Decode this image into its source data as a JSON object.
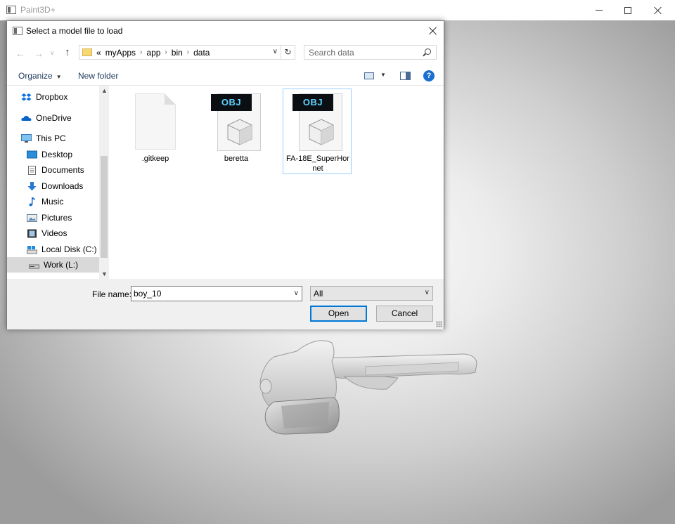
{
  "app": {
    "title": "Paint3D+"
  },
  "dialog": {
    "title": "Select a model file to load",
    "breadcrumb": [
      "«",
      "myApps",
      "app",
      "bin",
      "data"
    ],
    "search_placeholder": "Search data",
    "toolbar": {
      "organize_label": "Organize",
      "new_folder_label": "New folder"
    },
    "nav_items": [
      {
        "label": "Dropbox",
        "icon": "dropbox-icon"
      },
      {
        "label": "OneDrive",
        "icon": "onedrive-icon"
      },
      {
        "label": "This PC",
        "icon": "computer-icon"
      },
      {
        "label": "Desktop",
        "icon": "desktop-icon"
      },
      {
        "label": "Documents",
        "icon": "documents-icon"
      },
      {
        "label": "Downloads",
        "icon": "downloads-icon"
      },
      {
        "label": "Music",
        "icon": "music-icon"
      },
      {
        "label": "Pictures",
        "icon": "pictures-icon"
      },
      {
        "label": "Videos",
        "icon": "videos-icon"
      },
      {
        "label": "Local Disk (C:)",
        "icon": "local-disk-icon"
      },
      {
        "label": "Work (L:)",
        "icon": "drive-icon",
        "selected": true
      }
    ],
    "files": [
      {
        "name": ".gitkeep",
        "type": "blank-file"
      },
      {
        "name": "beretta",
        "type": "obj-file",
        "tag": "OBJ"
      },
      {
        "name": "FA-18E_SuperHornet",
        "type": "obj-file",
        "tag": "OBJ",
        "selected": true
      }
    ],
    "filename_label": "File name:",
    "filename_value": "boy_10",
    "filetype_value": "All",
    "open_label": "Open",
    "cancel_label": "Cancel"
  },
  "colors": {
    "accent": "#0078d7",
    "selection": "#99d1ff",
    "obj_tag_bg": "#0b0f14",
    "obj_tag_text": "#5fd3ff"
  }
}
